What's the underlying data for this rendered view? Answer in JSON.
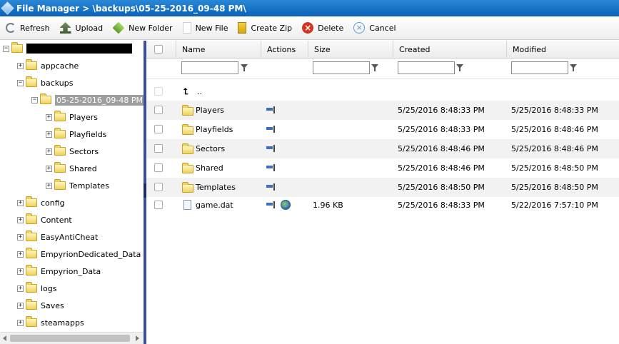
{
  "title": "File Manager > \\backups\\05-25-2016_09-48 PM\\",
  "toolbar": {
    "refresh": "Refresh",
    "upload": "Upload",
    "new_folder": "New Folder",
    "new_file": "New File",
    "create_zip": "Create Zip",
    "delete": "Delete",
    "cancel": "Cancel"
  },
  "tree": {
    "root": "",
    "appcache": "appcache",
    "backups": "backups",
    "selected": "05-25-2016_09-48 PM",
    "players": "Players",
    "playfields": "Playfields",
    "sectors": "Sectors",
    "shared": "Shared",
    "templates": "Templates",
    "config": "config",
    "content": "Content",
    "easyanticheat": "EasyAntiCheat",
    "dedicated": "EmpyrionDedicated_Data",
    "empyrion_data": "Empyrion_Data",
    "logs": "logs",
    "saves": "Saves",
    "steamapps": "steamapps"
  },
  "columns": {
    "name": "Name",
    "actions": "Actions",
    "size": "Size",
    "created": "Created",
    "modified": "Modified"
  },
  "filters": {
    "name": "",
    "size": "",
    "created": "",
    "modified": ""
  },
  "rows": {
    "up": "..",
    "r1": {
      "name": "Players",
      "size": "",
      "created": "5/25/2016 8:48:33 PM",
      "modified": "5/25/2016 8:48:33 PM"
    },
    "r2": {
      "name": "Playfields",
      "size": "",
      "created": "5/25/2016 8:48:33 PM",
      "modified": "5/25/2016 8:48:46 PM"
    },
    "r3": {
      "name": "Sectors",
      "size": "",
      "created": "5/25/2016 8:48:46 PM",
      "modified": "5/25/2016 8:48:46 PM"
    },
    "r4": {
      "name": "Shared",
      "size": "",
      "created": "5/25/2016 8:48:46 PM",
      "modified": "5/25/2016 8:48:50 PM"
    },
    "r5": {
      "name": "Templates",
      "size": "",
      "created": "5/25/2016 8:48:50 PM",
      "modified": "5/25/2016 8:48:50 PM"
    },
    "r6": {
      "name": "game.dat",
      "size": "1.96 KB",
      "created": "5/25/2016 8:48:33 PM",
      "modified": "5/22/2016 7:57:10 PM"
    }
  },
  "colors": {
    "titlebar": "#0a62b8",
    "splitter": "#3a4fa1",
    "selection": "#9e9e9e"
  }
}
